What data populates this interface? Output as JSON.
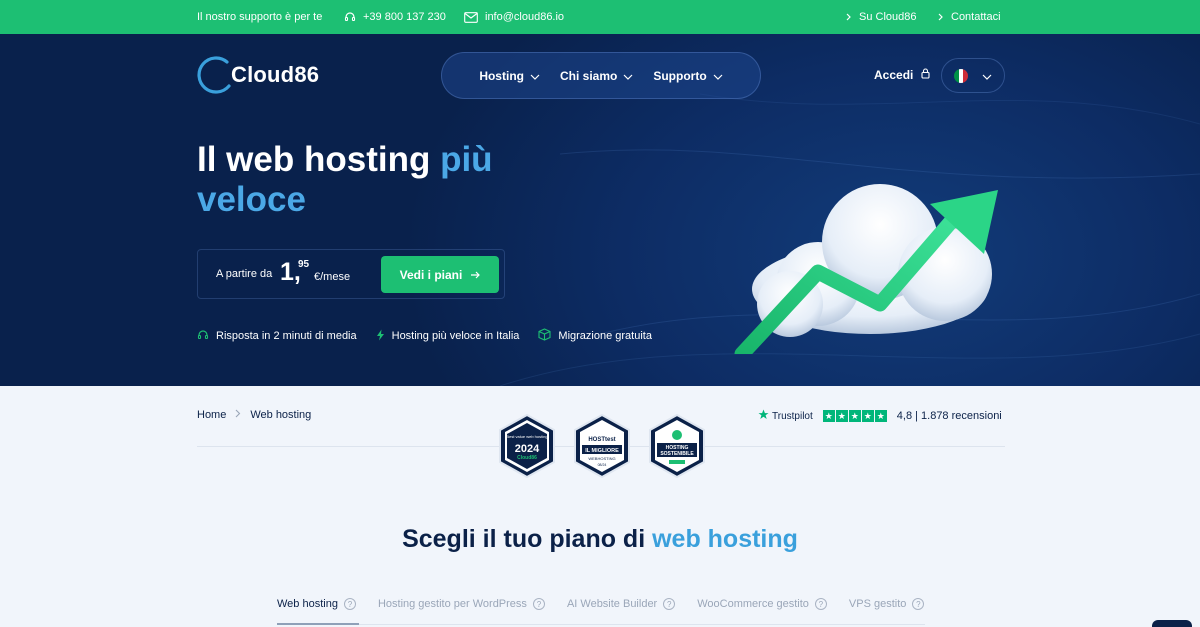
{
  "topbar": {
    "support_text": "Il nostro supporto è per te",
    "phone": "+39 800 137 230",
    "email": "info@cloud86.io",
    "links": [
      "Su Cloud86",
      "Contattaci"
    ]
  },
  "header": {
    "logo_text": "Cloud86",
    "nav": [
      "Hosting",
      "Chi siamo",
      "Supporto"
    ],
    "login_label": "Accedi",
    "language": "it"
  },
  "hero": {
    "title_line1": "Il web hosting ",
    "title_highlight1": "più",
    "title_line2": "veloce",
    "price_from": "A partire da",
    "price_int": "1,",
    "price_dec": "95",
    "price_unit": "€/mese",
    "cta_label": "Vedi i piani",
    "features": [
      {
        "icon": "headset-icon",
        "label": "Risposta in 2 minuti di media"
      },
      {
        "icon": "lightning-icon",
        "label": "Hosting più veloce in Italia"
      },
      {
        "icon": "box-icon",
        "label": "Migrazione gratuita"
      }
    ]
  },
  "breadcrumb": [
    "Home",
    "Web hosting"
  ],
  "badges": [
    {
      "top": "Best value web hosting",
      "year": "2024",
      "name": "Cloud86"
    },
    {
      "brand": "HOSTtest",
      "line1": "IL MIGLIORE",
      "line2": "WEBHOSTING",
      "date": "08/24"
    },
    {
      "line1": "HOSTING",
      "line2": "SOSTENIBILE"
    }
  ],
  "trustpilot": {
    "label": "Trustpilot",
    "rating_text": "4,8 | 1.878 recensioni",
    "stars": 5
  },
  "plans": {
    "title_prefix": "Scegli il tuo piano di ",
    "title_highlight": "web hosting",
    "tabs": [
      "Web hosting",
      "Hosting gestito per WordPress",
      "AI Website Builder",
      "WooCommerce gestito",
      "VPS gestito"
    ],
    "active_tab": 0
  },
  "colors": {
    "brand_green": "#1dbf73",
    "hero_dark": "#09214c",
    "accent_blue": "#4ba8e6",
    "navy_text": "#0b2148"
  }
}
